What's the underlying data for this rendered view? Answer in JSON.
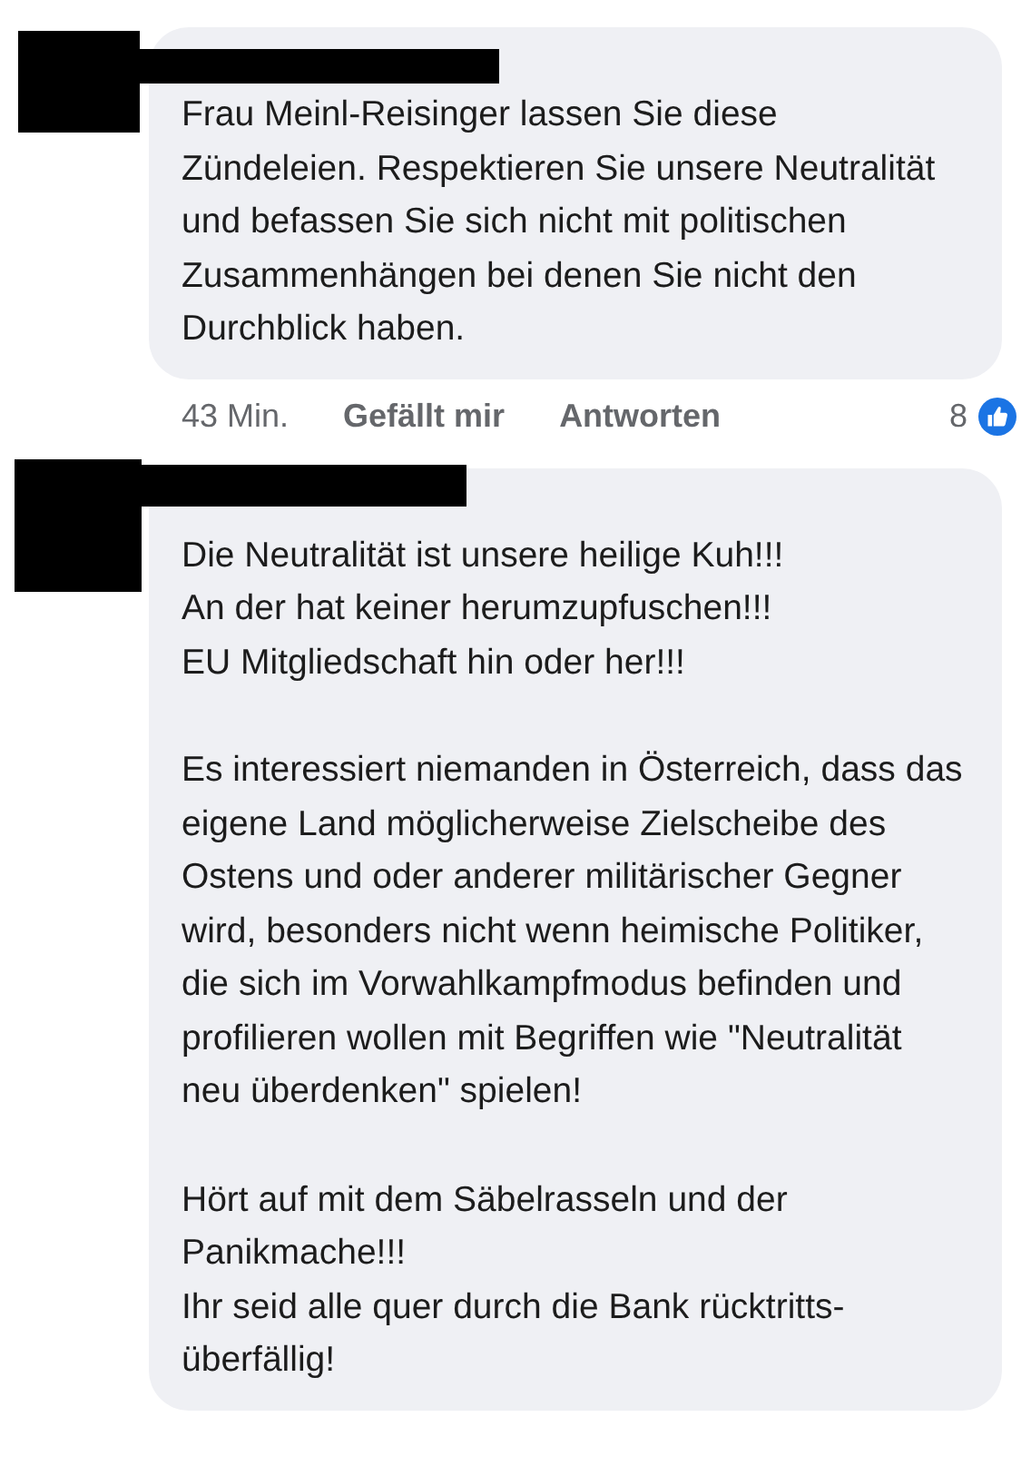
{
  "comments": [
    {
      "paragraphs": [
        "Frau Meinl-Reisinger lassen Sie diese Zündeleien. Respektieren Sie unsere Neutralität und befassen Sie sich nicht mit politischen Zusammenhängen bei denen Sie nicht den Durchblick haben."
      ],
      "time": "43 Min.",
      "actions": [
        "Gefällt mir",
        "Antworten"
      ],
      "reaction_count": "8"
    },
    {
      "paragraphs": [
        "Die Neutralität ist unsere heilige Kuh!!!\nAn der hat keiner herumzupfuschen!!!\nEU Mitgliedschaft hin oder her!!!",
        "Es interessiert niemanden in Österreich, dass das eigene Land möglicherweise Zielscheibe des Ostens und oder anderer militärischer Gegner wird, besonders nicht wenn heimische Politiker, die sich im Vorwahlkampfmodus befinden und profilieren wollen mit Begriffen wie \"Neutralität neu überdenken\" spielen!",
        "Hört auf mit dem Säbelrasseln und der Panikmache!!!\nIhr seid alle quer durch die Bank rücktritts-überfällig!"
      ]
    }
  ]
}
